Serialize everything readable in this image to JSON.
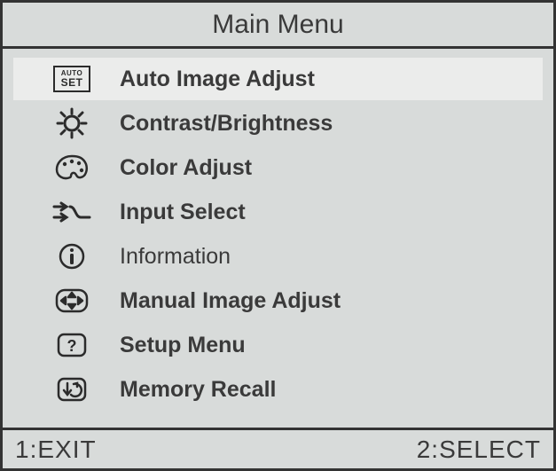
{
  "title": "Main Menu",
  "items": [
    {
      "label": "Auto Image Adjust",
      "icon": "auto-set-icon",
      "bold": true,
      "selected": true
    },
    {
      "label": "Contrast/Brightness",
      "icon": "brightness-icon",
      "bold": true,
      "selected": false
    },
    {
      "label": "Color Adjust",
      "icon": "palette-icon",
      "bold": true,
      "selected": false
    },
    {
      "label": "Input Select",
      "icon": "input-icon",
      "bold": true,
      "selected": false
    },
    {
      "label": "Information",
      "icon": "info-icon",
      "bold": false,
      "selected": false
    },
    {
      "label": "Manual Image Adjust",
      "icon": "manual-icon",
      "bold": true,
      "selected": false
    },
    {
      "label": "Setup Menu",
      "icon": "help-icon",
      "bold": true,
      "selected": false
    },
    {
      "label": "Memory Recall",
      "icon": "recall-icon",
      "bold": true,
      "selected": false
    }
  ],
  "footer": {
    "left": "1:EXIT",
    "right": "2:SELECT"
  },
  "autoset": {
    "line1": "AUTO",
    "line2": "SET"
  }
}
